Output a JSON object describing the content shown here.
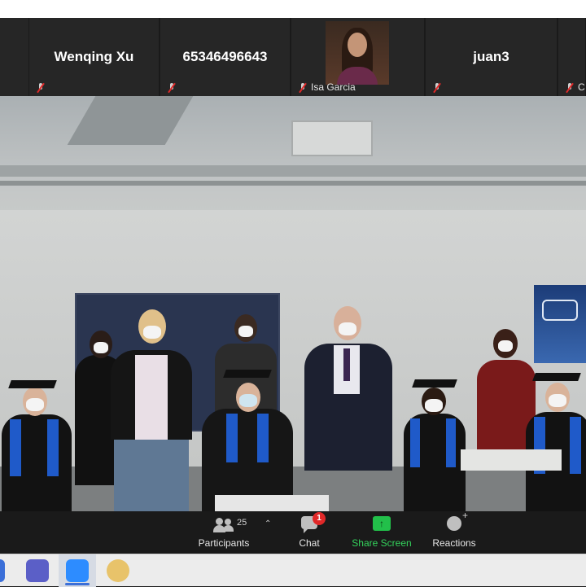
{
  "gallery": [
    {
      "name": "",
      "label": ""
    },
    {
      "name": "Wenqing Xu",
      "label": ""
    },
    {
      "name": "65346496643",
      "label": ""
    },
    {
      "name": "",
      "label": "Isa Garcia"
    },
    {
      "name": "juan3",
      "label": ""
    },
    {
      "name": "",
      "label": "Cl"
    }
  ],
  "toolbar": {
    "participants_label": "Participants",
    "participants_count": "25",
    "chat_label": "Chat",
    "chat_unread": "1",
    "share_label": "Share Screen",
    "reactions_label": "Reactions"
  },
  "taskbar": {
    "apps": [
      "teams-icon",
      "zoom-icon",
      "paint-icon"
    ]
  },
  "colors": {
    "share_green": "#22c04a",
    "badge_red": "#e02828",
    "toolbar_bg": "#1a1a1a"
  }
}
